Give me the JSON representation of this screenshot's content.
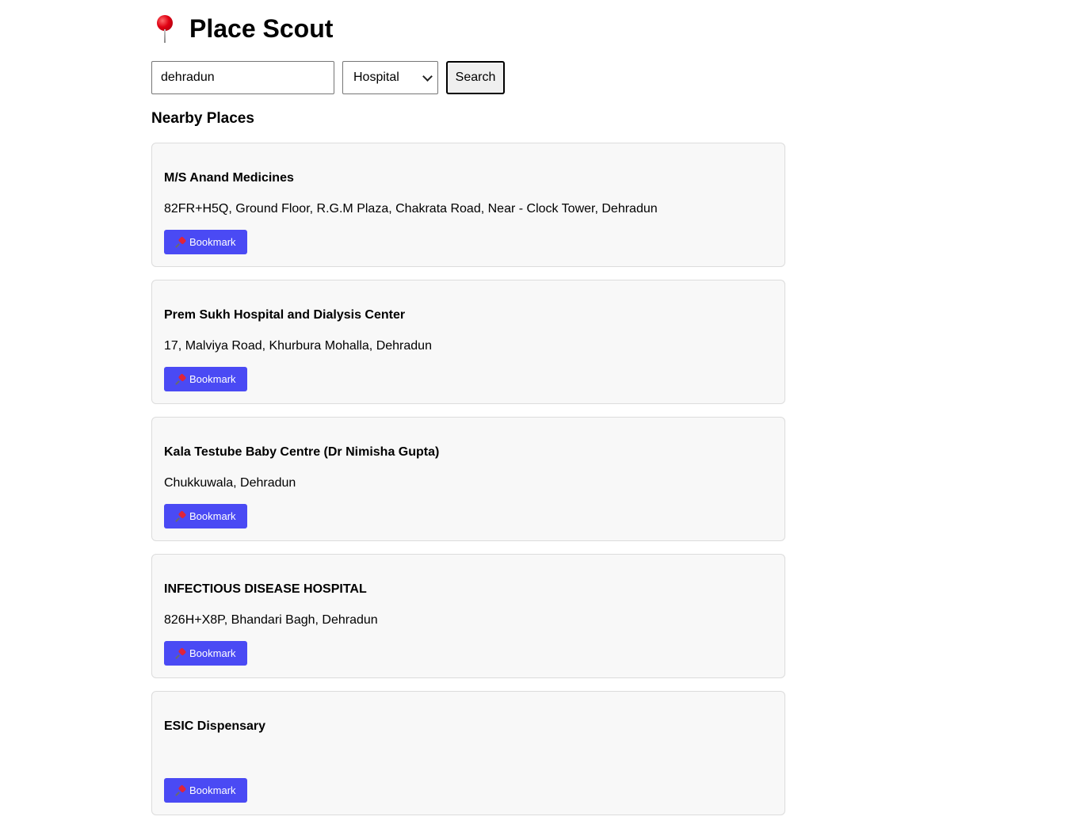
{
  "app": {
    "title": "Place Scout"
  },
  "search": {
    "query_value": "dehradun",
    "type_selected": "Hospital",
    "button_label": "Search"
  },
  "section": {
    "title": "Nearby Places"
  },
  "bookmark_label": "Bookmark",
  "places": [
    {
      "name": "M/S Anand Medicines",
      "address": "82FR+H5Q, Ground Floor, R.G.M Plaza, Chakrata Road, Near - Clock Tower, Dehradun"
    },
    {
      "name": "Prem Sukh Hospital and Dialysis Center",
      "address": "17, Malviya Road, Khurbura Mohalla, Dehradun"
    },
    {
      "name": "Kala Testube Baby Centre (Dr Nimisha Gupta)",
      "address": "Chukkuwala, Dehradun"
    },
    {
      "name": "INFECTIOUS DISEASE HOSPITAL",
      "address": "826H+X8P, Bhandari Bagh, Dehradun"
    },
    {
      "name": "ESIC Dispensary",
      "address": ""
    }
  ],
  "colors": {
    "bookmark_button": "#4a4af4",
    "card_background": "#f8f8f8",
    "card_border": "#dcdcdc",
    "pin_red": "#e00012"
  },
  "icons": {
    "title_icon": "round-pushpin-icon",
    "bookmark_icon": "pushpin-icon",
    "select_icon": "chevron-down-icon"
  }
}
